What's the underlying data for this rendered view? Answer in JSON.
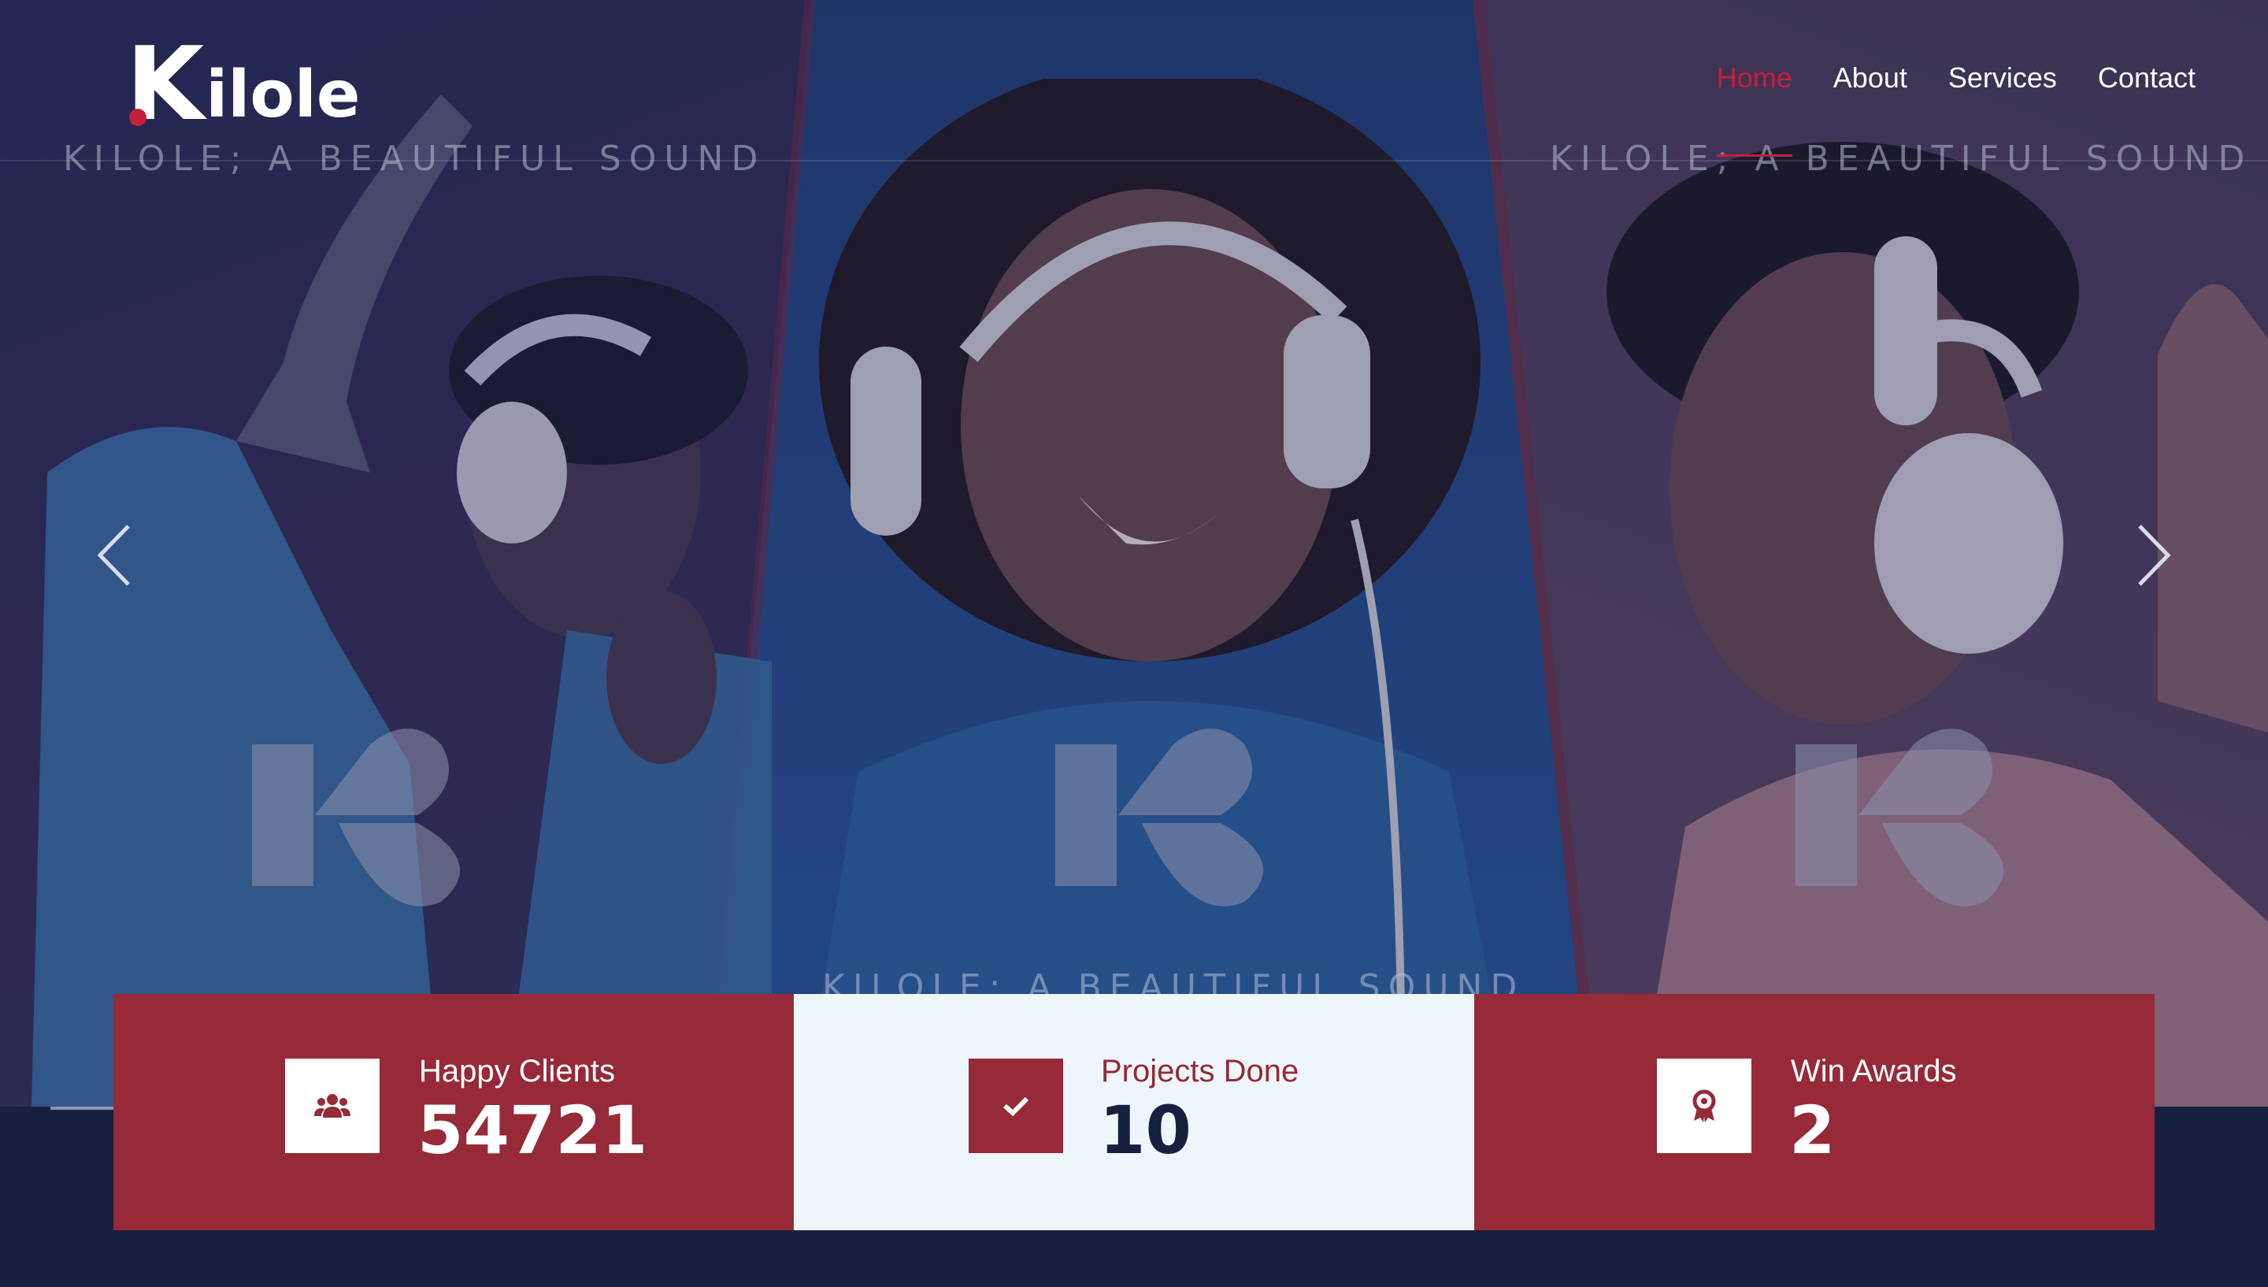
{
  "brand": {
    "logo_first": "K",
    "logo_rest": "ilole",
    "accent_color": "#c3203c",
    "dark_color": "#15213f"
  },
  "nav": {
    "items": [
      {
        "label": "Home",
        "active": true
      },
      {
        "label": "About",
        "active": false
      },
      {
        "label": "Services",
        "active": false
      },
      {
        "label": "Contact",
        "active": false
      }
    ]
  },
  "hero": {
    "watermark_text": "KILOLE; A BEAUTIFUL SOUND",
    "prev_icon": "chevron-left-icon",
    "next_icon": "chevron-right-icon"
  },
  "stats": [
    {
      "label": "Happy Clients",
      "value": "54721",
      "icon": "users-icon"
    },
    {
      "label": "Projects Done",
      "value": "10",
      "icon": "check-icon"
    },
    {
      "label": "Win Awards",
      "value": "2",
      "icon": "award-icon"
    }
  ]
}
